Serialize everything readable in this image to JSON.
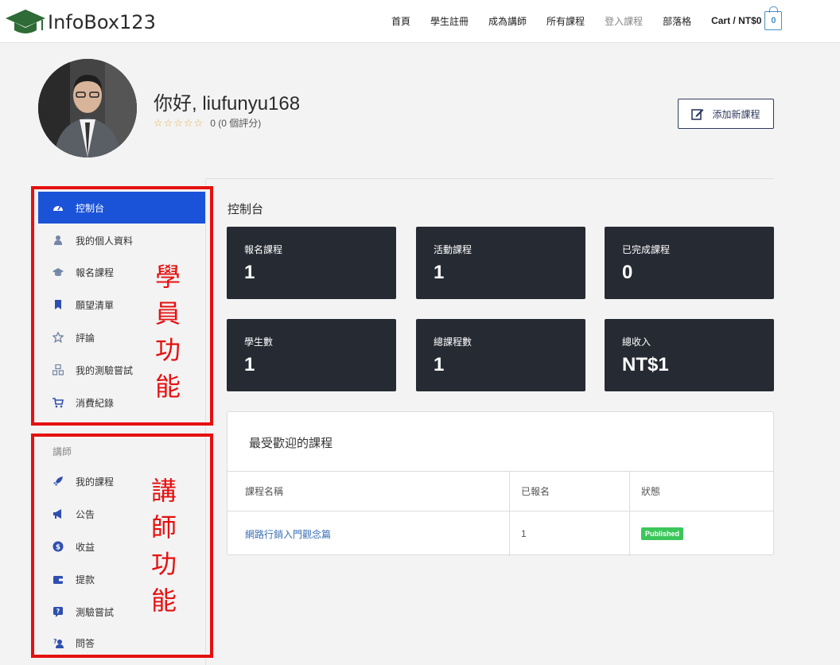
{
  "header": {
    "logo_text": "InfoBox123",
    "nav": [
      "首頁",
      "學生註冊",
      "成為講師",
      "所有課程",
      "登入課程",
      "部落格"
    ],
    "cart_label": "Cart / NT$0",
    "cart_count": "0"
  },
  "profile": {
    "greeting": "你好, liufunyu168",
    "rating_text": "0 (0 個評分)",
    "stars": "☆☆☆☆☆",
    "add_course_label": "添加新課程"
  },
  "sidebar": {
    "student_items": [
      {
        "label": "控制台",
        "icon": "dashboard-icon",
        "active": true
      },
      {
        "label": "我的個人資料",
        "icon": "user-icon"
      },
      {
        "label": "報名課程",
        "icon": "graduation-cap-icon"
      },
      {
        "label": "願望清單",
        "icon": "bookmark-icon"
      },
      {
        "label": "評論",
        "icon": "star-icon"
      },
      {
        "label": "我的測驗嘗試",
        "icon": "quiz-icon"
      },
      {
        "label": "消費紀錄",
        "icon": "cart-icon"
      }
    ],
    "instructor_label": "講師",
    "instructor_items": [
      {
        "label": "我的課程",
        "icon": "rocket-icon"
      },
      {
        "label": "公告",
        "icon": "megaphone-icon"
      },
      {
        "label": "收益",
        "icon": "dollar-icon"
      },
      {
        "label": "提款",
        "icon": "wallet-icon"
      },
      {
        "label": "測驗嘗試",
        "icon": "question-icon"
      },
      {
        "label": "問答",
        "icon": "qa-icon"
      }
    ]
  },
  "annotations": {
    "student": [
      "學",
      "員",
      "功",
      "能"
    ],
    "instructor": [
      "講",
      "師",
      "功",
      "能"
    ]
  },
  "dashboard": {
    "title": "控制台",
    "cards": [
      {
        "label": "報名課程",
        "value": "1"
      },
      {
        "label": "活動課程",
        "value": "1"
      },
      {
        "label": "已完成課程",
        "value": "0"
      },
      {
        "label": "學生數",
        "value": "1"
      },
      {
        "label": "總課程數",
        "value": "1"
      },
      {
        "label": "總收入",
        "value": "NT$1"
      }
    ],
    "popular": {
      "title": "最受歡迎的課程",
      "headers": [
        "課程名稱",
        "已報名",
        "狀態"
      ],
      "rows": [
        {
          "name": "網路行銷入門觀念篇",
          "enrolled": "1",
          "status": "Published"
        }
      ]
    }
  },
  "colors": {
    "accent": "#1b53d8",
    "card_bg": "#262a33",
    "annotation_red": "#e61010",
    "published_green": "#3cc65a"
  }
}
